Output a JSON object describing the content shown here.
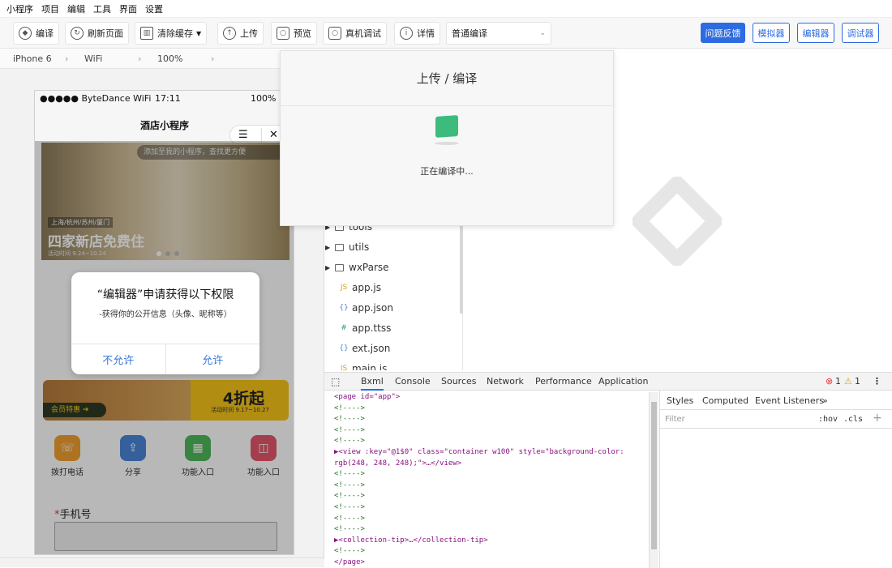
{
  "menu": [
    "小程序",
    "项目",
    "编辑",
    "工具",
    "界面",
    "设置"
  ],
  "toolbar": {
    "compile": "编译",
    "refresh": "刷新页面",
    "clear_cache": "清除缓存",
    "upload": "上传",
    "preview": "预览",
    "real_debug": "真机调试",
    "details": "详情",
    "compile_mode": "普通编译"
  },
  "right_buttons": {
    "feedback": "问题反馈",
    "simulator": "模拟器",
    "editor": "编辑器",
    "debugger": "调试器"
  },
  "devbar": {
    "device": "iPhone 6",
    "network": "WiFi",
    "zoom": "100%"
  },
  "phone": {
    "carrier": "●●●●● ByteDance WiFi",
    "time": "17:11",
    "battery": "100%",
    "title": "酒店小程序",
    "capsule_menu": "☰",
    "capsule_close": "✕",
    "banner_tip": "添加至我的小程序，查找更方便",
    "banner_city": "上海/杭州/苏州/厦门",
    "banner_headline": "四家新店免费住",
    "banner_date": "活动时间 9.24~10.24",
    "promo_tag": "会员特惠 ➔",
    "promo_discount": "4折起",
    "promo_date": "活动时间 9.17~10.27",
    "funcs": [
      {
        "label": "拨打电话",
        "color": "#f0a030",
        "glyph": "☏"
      },
      {
        "label": "分享",
        "color": "#4a86d8",
        "glyph": "⇪"
      },
      {
        "label": "功能入口",
        "color": "#4fb85a",
        "glyph": "▦"
      },
      {
        "label": "功能入口",
        "color": "#e4566a",
        "glyph": "◫"
      }
    ],
    "mobile_required": "*",
    "mobile_label": "手机号"
  },
  "modal": {
    "title": "“编辑器”申请获得以下权限",
    "desc": "-获得你的公开信息（头像、昵称等）",
    "deny": "不允许",
    "allow": "允许"
  },
  "overlay": {
    "title": "上传 / 编译",
    "message": "正在编译中..."
  },
  "tree": [
    {
      "name": "tools",
      "type": "folder"
    },
    {
      "name": "utils",
      "type": "folder"
    },
    {
      "name": "wxParse",
      "type": "folder"
    },
    {
      "name": "app.js",
      "type": "js"
    },
    {
      "name": "app.json",
      "type": "json"
    },
    {
      "name": "app.ttss",
      "type": "css"
    },
    {
      "name": "ext.json",
      "type": "json"
    },
    {
      "name": "main.js",
      "type": "js"
    }
  ],
  "devtools": {
    "tabs": [
      "Bxml",
      "Console",
      "Sources",
      "Network",
      "Performance",
      "Application"
    ],
    "errors": "1",
    "warnings": "1",
    "code": [
      {
        "k": "tag",
        "t": "<page id=\"app\">"
      },
      {
        "k": "c",
        "t": "  <!---->"
      },
      {
        "k": "c",
        "t": "  <!---->"
      },
      {
        "k": "c",
        "t": "  <!---->"
      },
      {
        "k": "c",
        "t": "  <!---->"
      },
      {
        "k": "tag",
        "t": "▶<view :key=\"@1$0\" class=\"container w100\" style=\"background-color:"
      },
      {
        "k": "tag",
        "t": "rgb(248, 248, 248);\">…</view>"
      },
      {
        "k": "c",
        "t": "  <!---->"
      },
      {
        "k": "c",
        "t": "  <!---->"
      },
      {
        "k": "c",
        "t": "  <!---->"
      },
      {
        "k": "c",
        "t": "  <!---->"
      },
      {
        "k": "c",
        "t": "  <!---->"
      },
      {
        "k": "c",
        "t": "  <!---->"
      },
      {
        "k": "tag",
        "t": "▶<collection-tip>…</collection-tip>"
      },
      {
        "k": "c",
        "t": "  <!---->"
      },
      {
        "k": "tag",
        "t": "</page>"
      }
    ],
    "style_tabs": [
      "Styles",
      "Computed",
      "Event Listeners",
      "»"
    ],
    "filter_placeholder": "Filter",
    "hov": ":hov",
    "cls": ".cls"
  }
}
